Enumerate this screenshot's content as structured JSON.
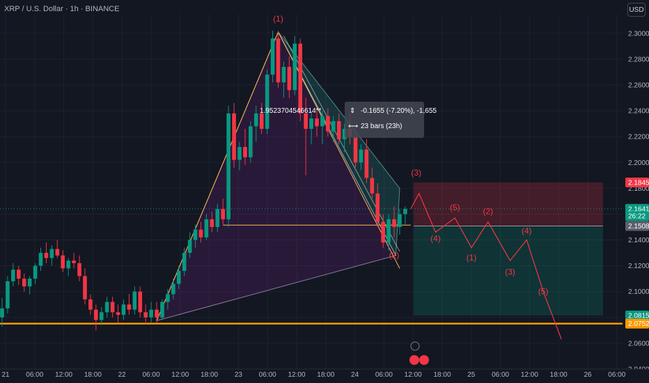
{
  "header": {
    "symbol_title": "XRP / U.S. Dollar · 1h · BINANCE",
    "currency_button": "USD"
  },
  "colors": {
    "up": "#089981",
    "down": "#f23645",
    "support": "#ff9800",
    "bg": "#131722",
    "wave": "#f23645"
  },
  "chart_data": {
    "type": "candlestick",
    "ylim": [
      2.04,
      2.315
    ],
    "y_ticks": [
      "2.3000",
      "2.2800",
      "2.2600",
      "2.2400",
      "2.2200",
      "2.2000",
      "2.1800",
      "2.1600",
      "2.1400",
      "2.1200",
      "2.1000",
      "2.0800",
      "2.0600",
      "2.0400"
    ],
    "x_ticks": [
      "21",
      "06:00",
      "12:00",
      "18:00",
      "22",
      "06:00",
      "12:00",
      "18:00",
      "23",
      "06:00",
      "12:00",
      "18:00",
      "24",
      "06:00",
      "12:00",
      "18:00",
      "25",
      "06:00",
      "12:00",
      "18:00",
      "26",
      "06:00"
    ],
    "candles": [
      [
        2.08,
        2.095,
        2.073,
        2.087
      ],
      [
        2.087,
        2.112,
        2.083,
        2.108
      ],
      [
        2.108,
        2.122,
        2.104,
        2.117
      ],
      [
        2.117,
        2.12,
        2.105,
        2.11
      ],
      [
        2.11,
        2.114,
        2.1,
        2.104
      ],
      [
        2.104,
        2.112,
        2.098,
        2.11
      ],
      [
        2.11,
        2.122,
        2.106,
        2.12
      ],
      [
        2.12,
        2.134,
        2.116,
        2.13
      ],
      [
        2.13,
        2.138,
        2.122,
        2.126
      ],
      [
        2.126,
        2.136,
        2.12,
        2.133
      ],
      [
        2.133,
        2.14,
        2.126,
        2.128
      ],
      [
        2.128,
        2.132,
        2.115,
        2.118
      ],
      [
        2.118,
        2.126,
        2.112,
        2.124
      ],
      [
        2.124,
        2.13,
        2.118,
        2.122
      ],
      [
        2.122,
        2.128,
        2.108,
        2.112
      ],
      [
        2.112,
        2.118,
        2.09,
        2.094
      ],
      [
        2.094,
        2.098,
        2.082,
        2.086
      ],
      [
        2.086,
        2.09,
        2.07,
        2.078
      ],
      [
        2.078,
        2.088,
        2.074,
        2.084
      ],
      [
        2.084,
        2.096,
        2.08,
        2.092
      ],
      [
        2.092,
        2.096,
        2.08,
        2.084
      ],
      [
        2.084,
        2.09,
        2.076,
        2.082
      ],
      [
        2.082,
        2.094,
        2.078,
        2.09
      ],
      [
        2.09,
        2.098,
        2.082,
        2.086
      ],
      [
        2.086,
        2.104,
        2.082,
        2.1
      ],
      [
        2.1,
        2.104,
        2.08,
        2.084
      ],
      [
        2.084,
        2.09,
        2.075,
        2.08
      ],
      [
        2.08,
        2.092,
        2.076,
        2.086
      ],
      [
        2.086,
        2.092,
        2.076,
        2.08
      ],
      [
        2.08,
        2.094,
        2.078,
        2.092
      ],
      [
        2.092,
        2.102,
        2.086,
        2.098
      ],
      [
        2.098,
        2.11,
        2.094,
        2.106
      ],
      [
        2.106,
        2.12,
        2.102,
        2.116
      ],
      [
        2.116,
        2.134,
        2.112,
        2.13
      ],
      [
        2.13,
        2.146,
        2.126,
        2.14
      ],
      [
        2.14,
        2.152,
        2.134,
        2.148
      ],
      [
        2.148,
        2.154,
        2.138,
        2.142
      ],
      [
        2.142,
        2.16,
        2.14,
        2.156
      ],
      [
        2.156,
        2.162,
        2.146,
        2.15
      ],
      [
        2.15,
        2.168,
        2.146,
        2.164
      ],
      [
        2.164,
        2.172,
        2.152,
        2.156
      ],
      [
        2.156,
        2.244,
        2.15,
        2.238
      ],
      [
        2.238,
        2.246,
        2.196,
        2.202
      ],
      [
        2.202,
        2.216,
        2.194,
        2.212
      ],
      [
        2.212,
        2.226,
        2.198,
        2.204
      ],
      [
        2.204,
        2.232,
        2.2,
        2.228
      ],
      [
        2.228,
        2.244,
        2.216,
        2.238
      ],
      [
        2.238,
        2.246,
        2.222,
        2.226
      ],
      [
        2.226,
        2.272,
        2.222,
        2.268
      ],
      [
        2.268,
        2.302,
        2.262,
        2.296
      ],
      [
        2.296,
        2.302,
        2.258,
        2.262
      ],
      [
        2.262,
        2.278,
        2.25,
        2.274
      ],
      [
        2.274,
        2.282,
        2.25,
        2.256
      ],
      [
        2.256,
        2.298,
        2.252,
        2.292
      ],
      [
        2.292,
        2.296,
        2.232,
        2.238
      ],
      [
        2.238,
        2.25,
        2.19,
        2.226
      ],
      [
        2.226,
        2.24,
        2.214,
        2.234
      ],
      [
        2.234,
        2.24,
        2.22,
        2.228
      ],
      [
        2.228,
        2.24,
        2.214,
        2.236
      ],
      [
        2.236,
        2.242,
        2.22,
        2.224
      ],
      [
        2.224,
        2.236,
        2.216,
        2.232
      ],
      [
        2.232,
        2.238,
        2.214,
        2.218
      ],
      [
        2.218,
        2.23,
        2.208,
        2.226
      ],
      [
        2.226,
        2.238,
        2.214,
        2.22
      ],
      [
        2.22,
        2.226,
        2.196,
        2.2
      ],
      [
        2.2,
        2.214,
        2.194,
        2.21
      ],
      [
        2.21,
        2.218,
        2.184,
        2.188
      ],
      [
        2.188,
        2.196,
        2.172,
        2.176
      ],
      [
        2.176,
        2.184,
        2.15,
        2.154
      ],
      [
        2.154,
        2.16,
        2.134,
        2.138
      ],
      [
        2.138,
        2.16,
        2.132,
        2.156
      ],
      [
        2.156,
        2.166,
        2.142,
        2.15
      ],
      [
        2.15,
        2.164,
        2.144,
        2.16
      ],
      [
        2.16,
        2.166,
        2.152,
        2.164
      ]
    ],
    "price_tags": [
      {
        "value": "2.1845",
        "y": 2.1845,
        "color": "#f23645"
      },
      {
        "value": "2.1641",
        "y": 2.1641,
        "color": "#089981"
      },
      {
        "value": "26:22",
        "y": 2.1585,
        "color": "#089981"
      },
      {
        "value": "2.1508",
        "y": 2.1508,
        "color": "#5d606b"
      },
      {
        "value": "2.0815",
        "y": 2.0815,
        "color": "#089981"
      },
      {
        "value": "2.0752",
        "y": 2.0752,
        "color": "#ff9800"
      }
    ],
    "wave_labels": [
      {
        "text": "(1)",
        "bar": 50,
        "y": 2.309
      },
      {
        "text": "(2)",
        "bar": 71,
        "y": 2.126
      },
      {
        "text": "(3)",
        "bar": 75,
        "y": 2.19
      },
      {
        "text": "(5)",
        "bar": 82,
        "y": 2.163
      },
      {
        "text": "(4)",
        "bar": 78.5,
        "y": 2.139
      },
      {
        "text": "(2)",
        "bar": 88,
        "y": 2.16
      },
      {
        "text": "(1)",
        "bar": 85,
        "y": 2.124
      },
      {
        "text": "(4)",
        "bar": 95,
        "y": 2.145
      },
      {
        "text": "(3)",
        "bar": 92,
        "y": 2.113
      },
      {
        "text": "(5)",
        "bar": 98,
        "y": 2.098
      }
    ],
    "measure_tooltip": {
      "line1": "-0.1655 (-7.20%), -1,655",
      "line2": "23 bars (23h)"
    },
    "harmonic_value_text": "1.9523704546614**"
  }
}
